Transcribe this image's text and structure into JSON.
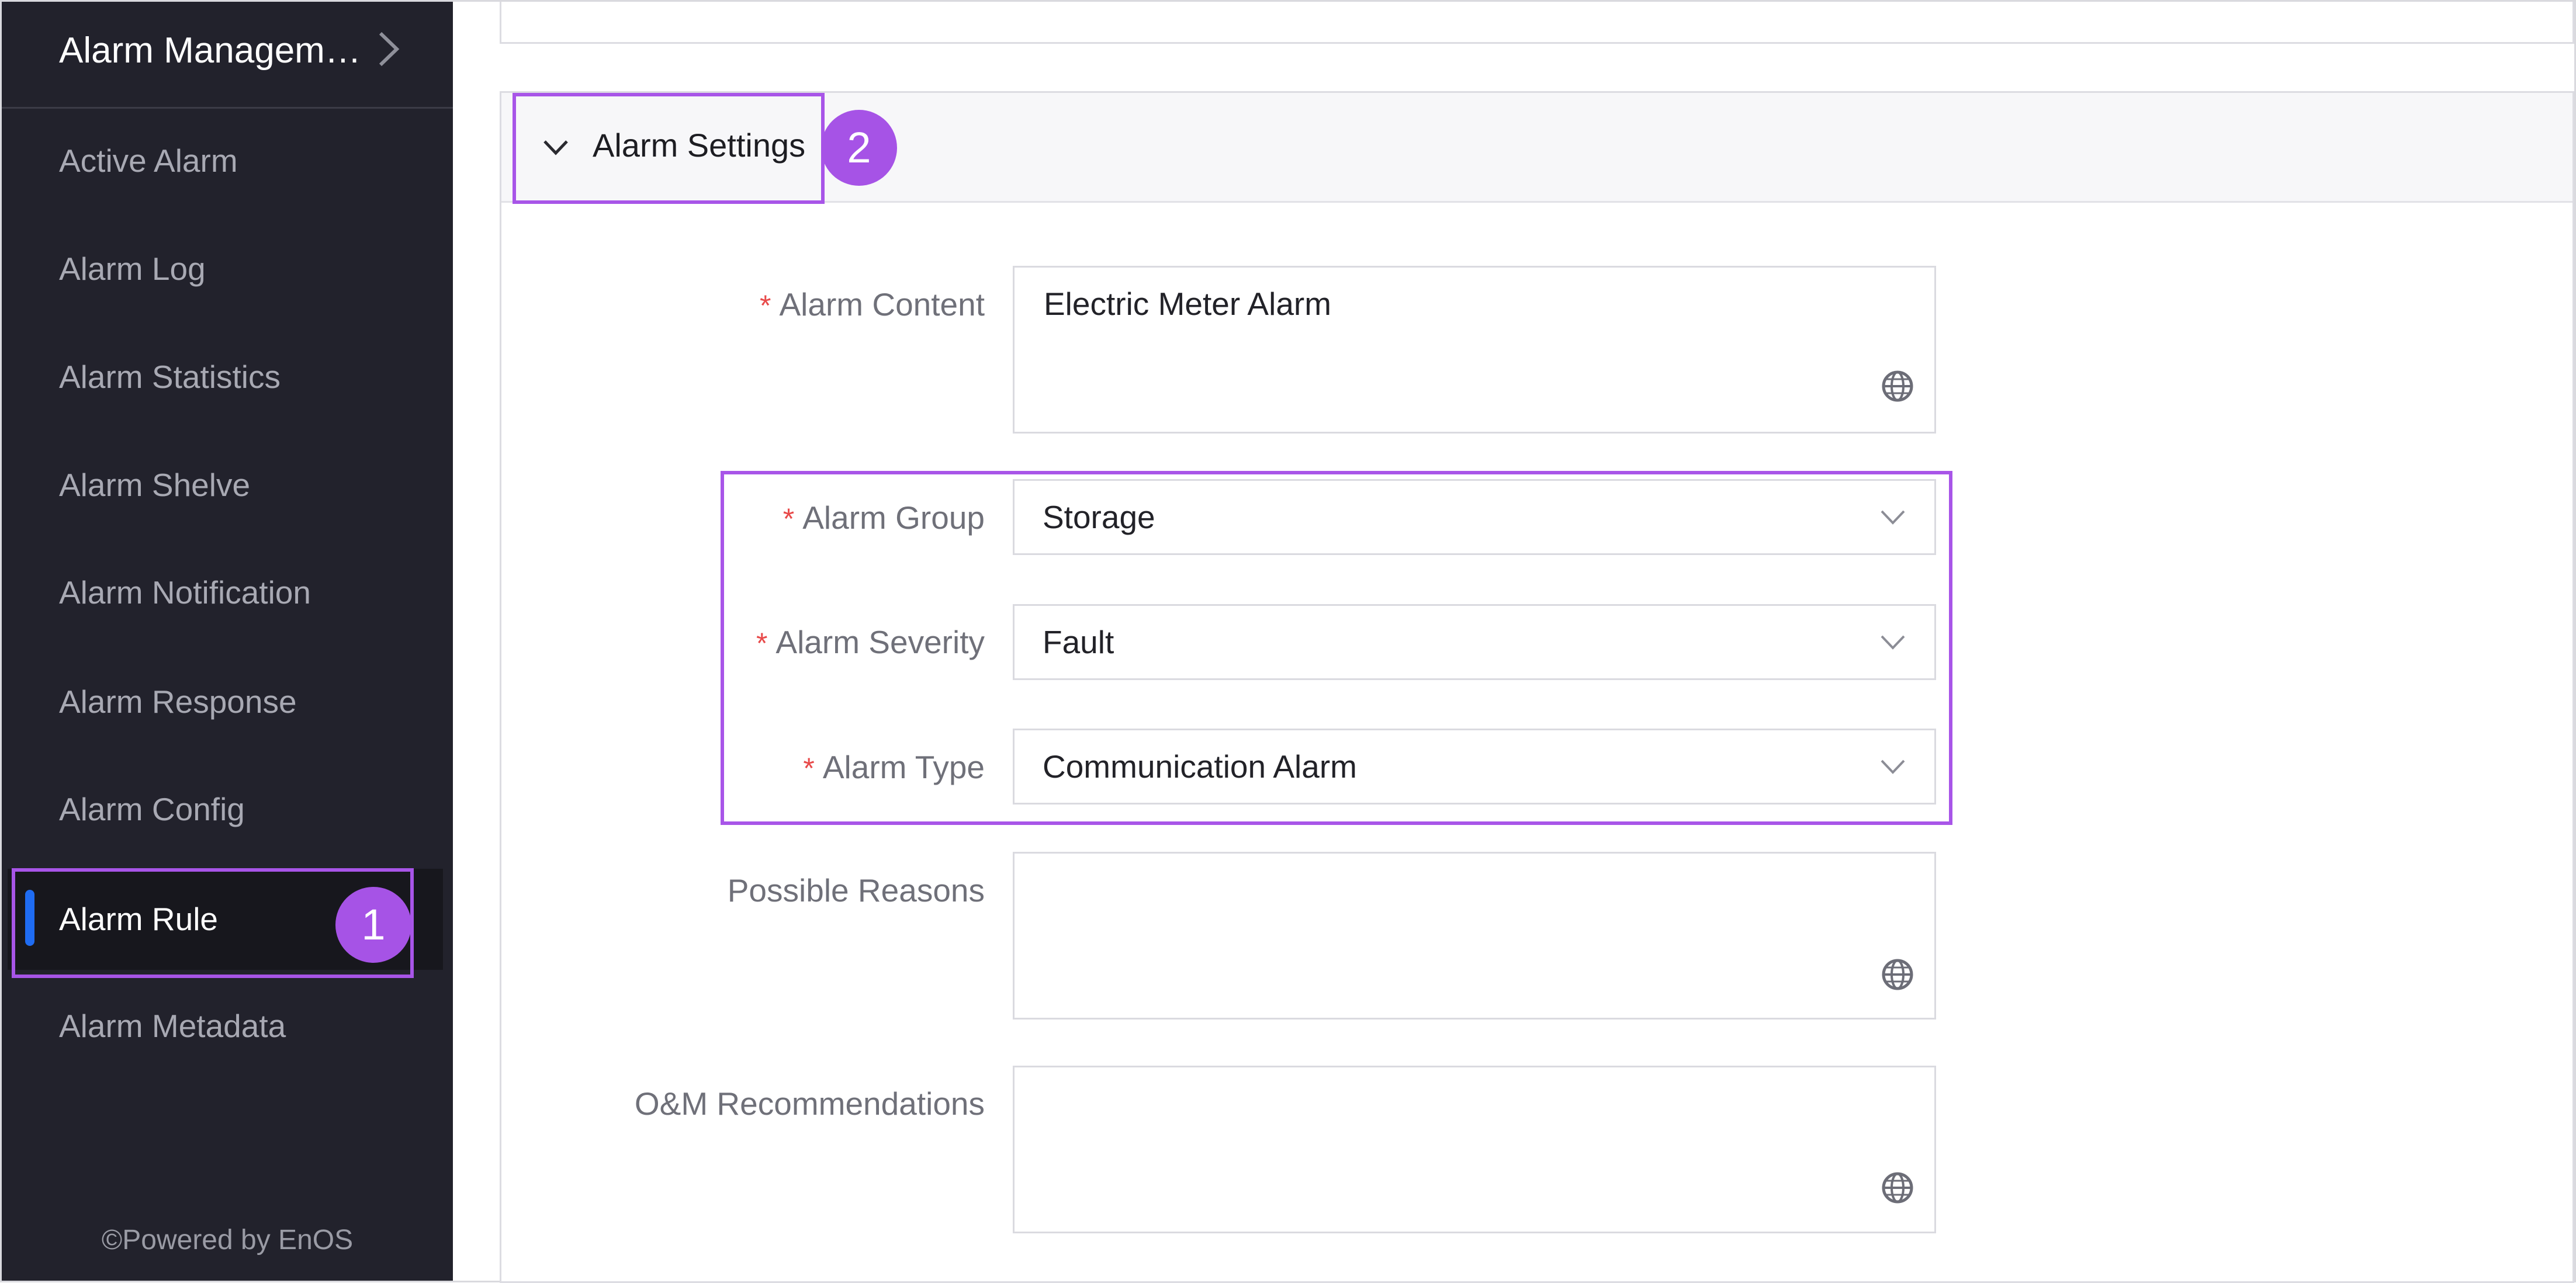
{
  "sidebar": {
    "title": "Alarm Managem…",
    "items": [
      {
        "label": "Active Alarm"
      },
      {
        "label": "Alarm Log"
      },
      {
        "label": "Alarm Statistics"
      },
      {
        "label": "Alarm Shelve"
      },
      {
        "label": "Alarm Notification"
      },
      {
        "label": "Alarm Response"
      },
      {
        "label": "Alarm Config"
      },
      {
        "label": "Alarm Rule",
        "active": true
      },
      {
        "label": "Alarm Metadata"
      }
    ],
    "footer": "©Powered by EnOS"
  },
  "annotations": {
    "badge1": "1",
    "badge2": "2",
    "color": "#a855e8"
  },
  "section": {
    "title": "Alarm Settings"
  },
  "form": {
    "required_mark": "*",
    "alarm_content": {
      "label": "Alarm Content",
      "value": "Electric Meter Alarm"
    },
    "alarm_group": {
      "label": "Alarm Group",
      "value": "Storage"
    },
    "alarm_severity": {
      "label": "Alarm Severity",
      "value": "Fault"
    },
    "alarm_type": {
      "label": "Alarm Type",
      "value": "Communication Alarm"
    },
    "possible_reasons": {
      "label": "Possible Reasons",
      "value": ""
    },
    "om_recommendations": {
      "label": "O&M Recommendations",
      "value": ""
    }
  },
  "colors": {
    "sidebar_bg": "#22222c",
    "active_indicator": "#1f6cf2",
    "required": "#e84a4a"
  },
  "icons": {
    "sidebar_expand": "chevron-right-icon",
    "collapse": "chevron-down-icon",
    "translate": "globe-icon",
    "select_arrow": "chevron-down-icon"
  }
}
